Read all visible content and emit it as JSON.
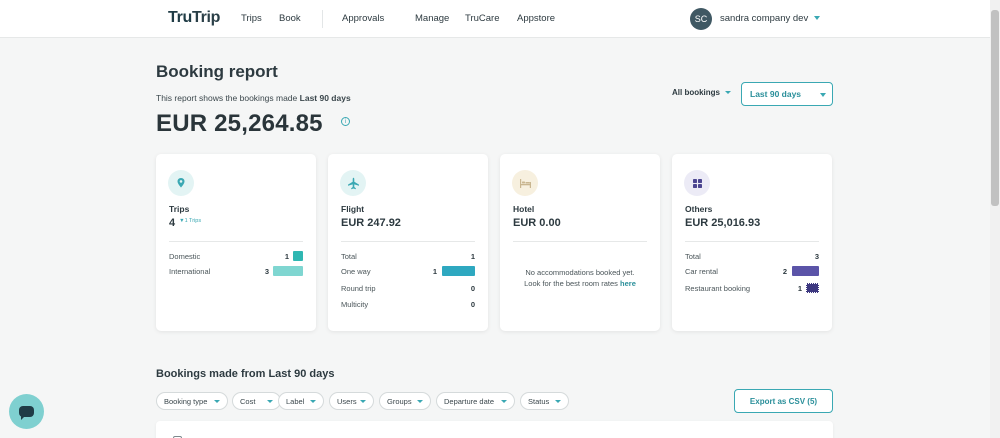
{
  "header": {
    "logo": {
      "part1": "Tru",
      "part2": "Trip"
    },
    "nav": [
      "Trips",
      "Book",
      "Approvals",
      "Manage",
      "TruCare",
      "Appstore"
    ],
    "user": {
      "initials": "SC",
      "name": "sandra company dev"
    }
  },
  "report": {
    "title": "Booking report",
    "subtitle_prefix": "This report shows the bookings made",
    "subtitle_period": "Last 90 days",
    "total": "EUR 25,264.85",
    "info_glyph": "i",
    "filter_all": "All bookings",
    "filter_period": "Last 90 days"
  },
  "cards": {
    "trips": {
      "icon": "location-pin-icon",
      "label": "Trips",
      "value": "4",
      "sub": "▼1 Trips",
      "rows": [
        {
          "label": "Domestic",
          "count": "1"
        },
        {
          "label": "International",
          "count": "3"
        }
      ]
    },
    "flight": {
      "icon": "airplane-icon",
      "label": "Flight",
      "value": "EUR 247.92",
      "rows": [
        {
          "label": "Total",
          "count": "1"
        },
        {
          "label": "One way",
          "count": "1"
        },
        {
          "label": "Round trip",
          "count": "0"
        },
        {
          "label": "Multicity",
          "count": "0"
        }
      ]
    },
    "hotel": {
      "icon": "bed-icon",
      "label": "Hotel",
      "value": "EUR 0.00",
      "empty_text": "No accommodations booked yet. Look for the best room rates",
      "empty_link": "here"
    },
    "others": {
      "icon": "grid-icon",
      "label": "Others",
      "value": "EUR 25,016.93",
      "rows": [
        {
          "label": "Total",
          "count": "3"
        },
        {
          "label": "Car rental",
          "count": "2"
        },
        {
          "label": "Restaurant booking",
          "count": "1"
        }
      ]
    }
  },
  "bookings": {
    "title": "Bookings made from Last 90 days",
    "filters": [
      "Booking type",
      "Cost",
      "Label",
      "Users",
      "Groups",
      "Departure date",
      "Status"
    ],
    "export_label": "Export as CSV (5)"
  },
  "colors": {
    "accent": "#3aa8b3",
    "trips_bar": "#2fb7b2",
    "flight_bar": "#2ea8c0",
    "others_bar": "#5b54a8",
    "chat": "#7fd0d0"
  }
}
